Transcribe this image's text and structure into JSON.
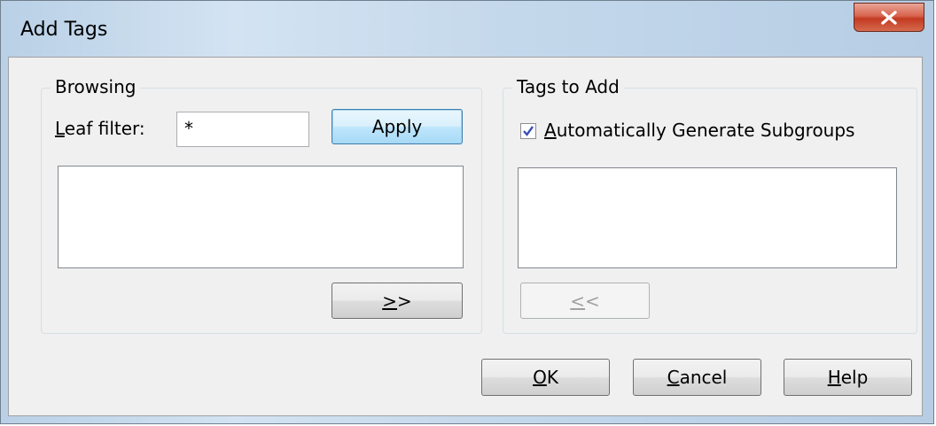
{
  "window": {
    "title": "Add Tags"
  },
  "title_controls": {
    "close_icon": "close-icon"
  },
  "browsing": {
    "group_label": "Browsing",
    "leaf_filter_label": "Leaf filter:",
    "leaf_filter_mnemonic": "L",
    "leaf_filter_rest": "eaf filter:",
    "leaf_filter_value": "*",
    "apply_label": "Apply",
    "add_button_label": ">>",
    "add_button_mnemonic": ">",
    "add_button_rest": ">",
    "items": []
  },
  "tags_to_add": {
    "group_label": "Tags to Add",
    "auto_generate_checked": true,
    "auto_generate_label": "Automatically Generate Subgroups",
    "auto_generate_mnemonic": "A",
    "auto_generate_rest": "utomatically Generate Subgroups",
    "remove_button_label": "<<",
    "remove_button_mnemonic": "<",
    "remove_button_rest": "<",
    "remove_button_enabled": false,
    "items": []
  },
  "footer": {
    "ok_label": "OK",
    "ok_mnemonic": "O",
    "ok_rest": "K",
    "cancel_label": "Cancel",
    "cancel_mnemonic": "C",
    "cancel_rest": "ancel",
    "help_label": "Help",
    "help_mnemonic": "H",
    "help_rest": "elp"
  },
  "colors": {
    "title_gradient": "#c4d8eb",
    "close_red": "#c33a22",
    "client_bg": "#f0f0f0",
    "default_button_border": "#3c7fb1"
  }
}
